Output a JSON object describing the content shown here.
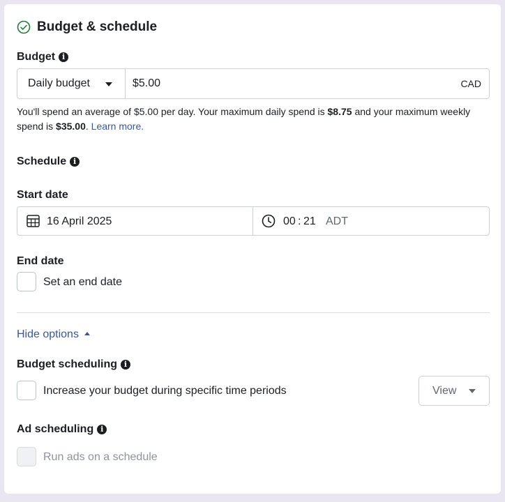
{
  "section": {
    "title": "Budget & schedule"
  },
  "budget": {
    "label": "Budget",
    "type_selected": "Daily budget",
    "amount": "$5.00",
    "currency": "CAD",
    "help_part1": "You'll spend an average of $5.00 per day. Your maximum daily spend is ",
    "help_bold1": "$8.75",
    "help_part2": " and your maximum weekly spend is ",
    "help_bold2": "$35.00",
    "help_part3": ".",
    "learn_more": "Learn more."
  },
  "schedule": {
    "label": "Schedule",
    "start_date_label": "Start date",
    "start_date": "16 April 2025",
    "time_hour": "00",
    "time_sep": ":",
    "time_minute": "21",
    "timezone": "ADT",
    "end_date_label": "End date",
    "end_date_checkbox": "Set an end date"
  },
  "options": {
    "toggle_label": "Hide options",
    "budget_scheduling_label": "Budget scheduling",
    "budget_scheduling_checkbox": "Increase your budget during specific time periods",
    "view_button": "View",
    "ad_scheduling_label": "Ad scheduling",
    "ad_scheduling_checkbox": "Run ads on a schedule"
  },
  "colors": {
    "link": "#385898",
    "check_green": "#42b72a",
    "border": "#ccd0d5"
  }
}
